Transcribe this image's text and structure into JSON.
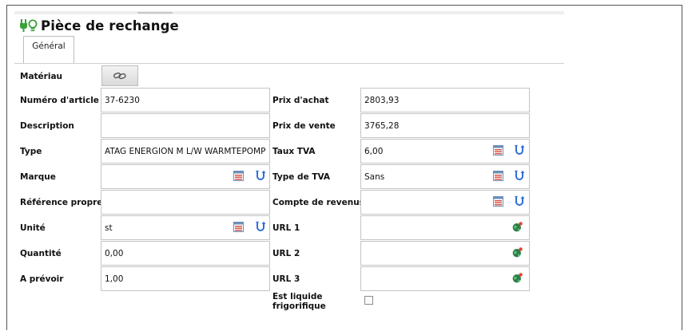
{
  "title": "Pièce de rechange",
  "tabs": [
    {
      "label": "Général"
    }
  ],
  "left_fields": {
    "materiau": {
      "label": "Matériau"
    },
    "numero_article": {
      "label": "Numéro d'article",
      "value": "37-6230"
    },
    "description": {
      "label": "Description",
      "value": ""
    },
    "type": {
      "label": "Type",
      "value": "ATAG ENERGION M L/W WARMTEPOMP"
    },
    "marque": {
      "label": "Marque",
      "value": ""
    },
    "reference_propre": {
      "label": "Référence propre",
      "value": ""
    },
    "unite": {
      "label": "Unité",
      "value": "st"
    },
    "quantite": {
      "label": "Quantité",
      "value": "0,00"
    },
    "a_prevoir": {
      "label": "A prévoir",
      "value": "1,00"
    }
  },
  "right_fields": {
    "prix_achat": {
      "label": "Prix d'achat",
      "value": "2803,93"
    },
    "prix_vente": {
      "label": "Prix de vente",
      "value": "3765,28"
    },
    "taux_tva": {
      "label": "Taux TVA",
      "value": "6,00"
    },
    "type_tva": {
      "label": "Type de TVA",
      "value": "Sans"
    },
    "compte_revenus": {
      "label": "Compte de revenus",
      "value": ""
    },
    "url1": {
      "label": "URL 1",
      "value": ""
    },
    "url2": {
      "label": "URL 2",
      "value": ""
    },
    "url3": {
      "label": "URL 3",
      "value": ""
    },
    "liquide_frigorifique": {
      "label_line1": "Est liquide",
      "label_line2": "frigorifique",
      "checked": false
    }
  },
  "icons": {
    "title": [
      "plug-icon",
      "lightbulb-icon"
    ],
    "material": "link-icon",
    "picker": "calendar-list-icon",
    "swap": "swap-icon",
    "url": "globe-icon"
  },
  "colors": {
    "accent_green": "#3aa23a",
    "swap_blue": "#2f6fd6",
    "calendar_red": "#d64a3a"
  }
}
